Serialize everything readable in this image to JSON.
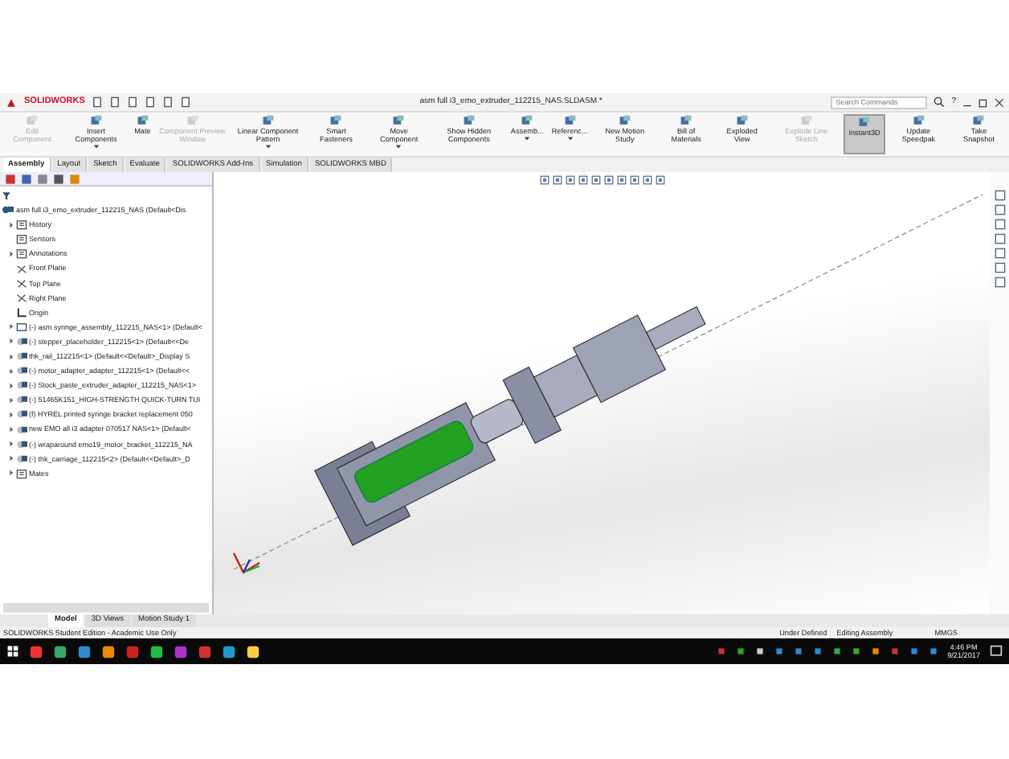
{
  "window": {
    "app_name": "SOLIDWORKS",
    "title": "asm full i3_emo_extruder_112215_NAS.SLDASM *",
    "search": {
      "placeholder": "Search Commands"
    },
    "help": "?"
  },
  "ribbon": [
    {
      "label": "Edit Component",
      "disabled": true,
      "selected": false,
      "dropdown": false
    },
    {
      "label": "Insert Components",
      "disabled": false,
      "selected": false,
      "dropdown": true
    },
    {
      "label": "Mate",
      "disabled": false,
      "selected": false,
      "dropdown": false
    },
    {
      "label": "Component Preview Window",
      "disabled": true,
      "selected": false,
      "dropdown": false
    },
    {
      "label": "Linear Component Pattern",
      "disabled": false,
      "selected": false,
      "dropdown": true
    },
    {
      "label": "Smart Fasteners",
      "disabled": false,
      "selected": false,
      "dropdown": false
    },
    {
      "label": "Move Component",
      "disabled": false,
      "selected": false,
      "dropdown": true
    },
    {
      "label": "Show Hidden Components",
      "disabled": false,
      "selected": false,
      "dropdown": false
    },
    {
      "label": "Assemb...",
      "disabled": false,
      "selected": false,
      "dropdown": true
    },
    {
      "label": "Referenc...",
      "disabled": false,
      "selected": false,
      "dropdown": true
    },
    {
      "label": "New Motion Study",
      "disabled": false,
      "selected": false,
      "dropdown": false
    },
    {
      "label": "Bill of Materials",
      "disabled": false,
      "selected": false,
      "dropdown": false
    },
    {
      "label": "Exploded View",
      "disabled": false,
      "selected": false,
      "dropdown": false
    },
    {
      "label": "Explode Line Sketch",
      "disabled": true,
      "selected": false,
      "dropdown": false
    },
    {
      "label": "Instant3D",
      "disabled": false,
      "selected": true,
      "dropdown": false
    },
    {
      "label": "Update Speedpak",
      "disabled": false,
      "selected": false,
      "dropdown": false
    },
    {
      "label": "Take Snapshot",
      "disabled": false,
      "selected": false,
      "dropdown": false
    }
  ],
  "tabs": [
    {
      "label": "Assembly",
      "selected": true
    },
    {
      "label": "Layout",
      "selected": false
    },
    {
      "label": "Sketch",
      "selected": false
    },
    {
      "label": "Evaluate",
      "selected": false
    },
    {
      "label": "SOLIDWORKS Add-Ins",
      "selected": false
    },
    {
      "label": "Simulation",
      "selected": false
    },
    {
      "label": "SOLIDWORKS MBD",
      "selected": false
    }
  ],
  "tree": {
    "root": "asm full i3_emo_extruder_112215_NAS  (Default<Dis",
    "items": [
      {
        "label": "History",
        "kind": "folder",
        "expandable": true
      },
      {
        "label": "Sensors",
        "kind": "folder",
        "expandable": false
      },
      {
        "label": "Annotations",
        "kind": "folder",
        "expandable": true
      },
      {
        "label": "Front Plane",
        "kind": "plane",
        "expandable": false
      },
      {
        "label": "Top Plane",
        "kind": "plane",
        "expandable": false
      },
      {
        "label": "Right Plane",
        "kind": "plane",
        "expandable": false
      },
      {
        "label": "Origin",
        "kind": "origin",
        "expandable": false
      },
      {
        "label": "(-) asm syringe_assembly_112215_NAS<1> (Default<",
        "kind": "assembly",
        "expandable": true
      },
      {
        "label": "(-) stepper_placeholder_112215<1> (Default<<De",
        "kind": "part",
        "expandable": true
      },
      {
        "label": "thk_rail_112215<1> (Default<<Default>_Display S",
        "kind": "part",
        "expandable": true
      },
      {
        "label": "(-) motor_adapter_adapter_112215<1> (Default<<",
        "kind": "part",
        "expandable": true
      },
      {
        "label": "(-) Stock_paste_extruder_adapter_112215_NAS<1>",
        "kind": "part",
        "expandable": true
      },
      {
        "label": "(-) 51465K151_HIGH-STRENGTH QUICK-TURN TUI",
        "kind": "part",
        "expandable": true
      },
      {
        "label": "(f) HYREL printed syringe bracket replacement 050",
        "kind": "part",
        "expandable": true
      },
      {
        "label": "new EMO all i3 adapter 070517 NAS<1> (Default<",
        "kind": "part",
        "expandable": true
      },
      {
        "label": "(-) wraparound emo19_motor_bracket_112215_NA",
        "kind": "part",
        "expandable": true
      },
      {
        "label": "(-) thk_carriage_112215<2> (Default<<Default>_D",
        "kind": "part",
        "expandable": true
      },
      {
        "label": "Mates",
        "kind": "folder",
        "expandable": true
      }
    ]
  },
  "bottom_tabs": [
    {
      "label": "Model",
      "selected": true
    },
    {
      "label": "3D Views",
      "selected": false
    },
    {
      "label": "Motion Study 1",
      "selected": false
    }
  ],
  "status_bar": {
    "edition": "SOLIDWORKS Student Edition - Academic Use Only",
    "state": "Under Defined",
    "mode": "Editing Assembly",
    "units": "MMGS"
  },
  "taskbar": {
    "time": "4:46 PM",
    "date": "9/21/2017"
  }
}
